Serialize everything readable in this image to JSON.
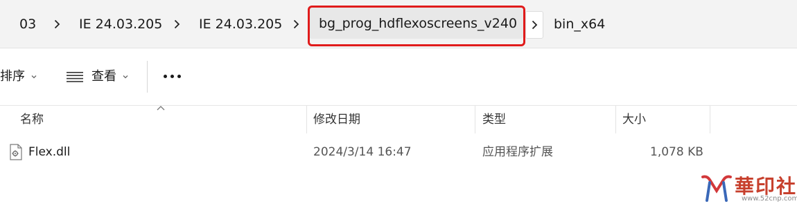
{
  "breadcrumb": {
    "items": [
      "03",
      "IE 24.03.205",
      "IE 24.03.205"
    ],
    "current": "bg_prog_hdflexoscreens_v240",
    "next": "bin_x64"
  },
  "toolbar": {
    "sort_label": "排序",
    "view_label": "查看",
    "more_label": "..."
  },
  "columns": {
    "name": "名称",
    "date": "修改日期",
    "type": "类型",
    "size": "大小"
  },
  "files": [
    {
      "name": "Flex.dll",
      "modified": "2024/3/14 16:47",
      "type": "应用程序扩展",
      "size": "1,078 KB"
    }
  ],
  "watermark": {
    "text": "華印社區",
    "url": "www.52cnp.com"
  },
  "colors": {
    "highlight": "#e01b1b",
    "watermark": "#c7402d"
  }
}
